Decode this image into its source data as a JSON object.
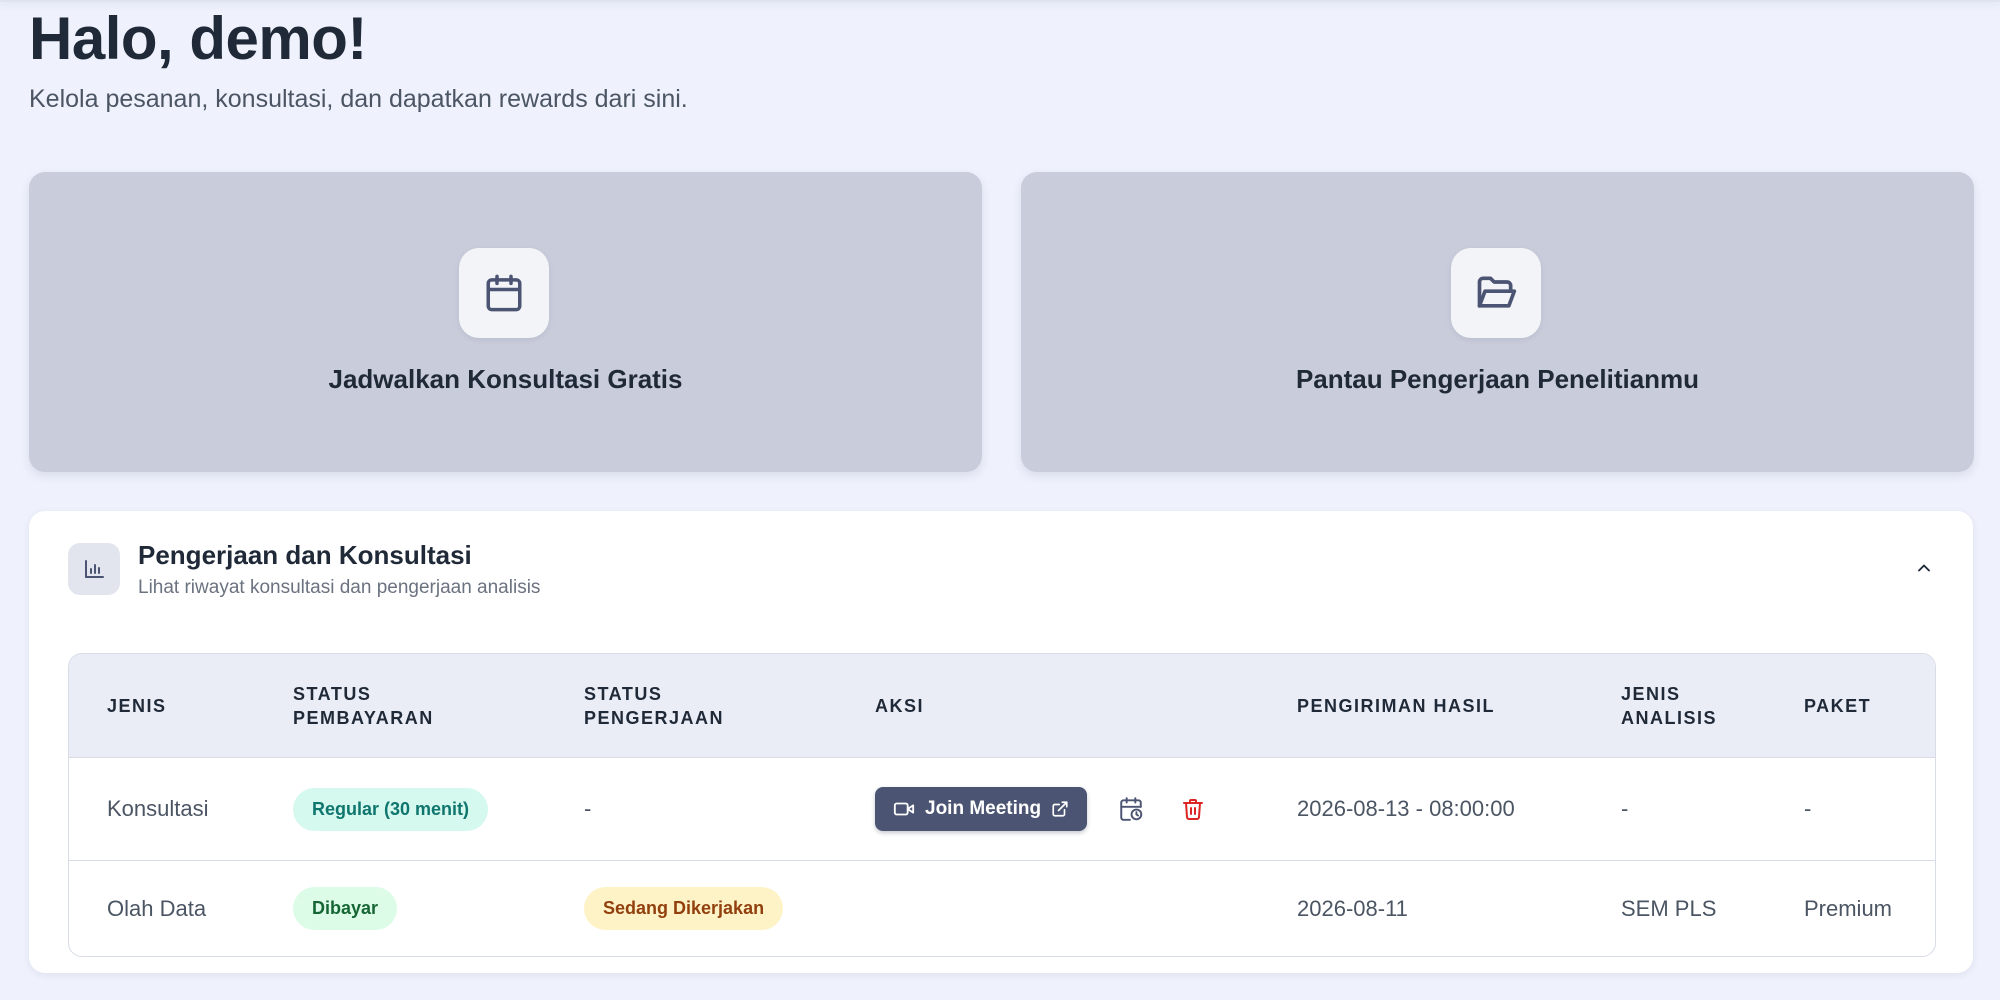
{
  "header": {
    "greeting": "Halo, demo!",
    "subtitle": "Kelola pesanan, konsultasi, dan dapatkan rewards dari sini."
  },
  "cards": [
    {
      "label": "Jadwalkan Konsultasi Gratis",
      "icon": "calendar-icon"
    },
    {
      "label": "Pantau Pengerjaan Penelitianmu",
      "icon": "folder-open-icon"
    }
  ],
  "panel": {
    "title": "Pengerjaan dan Konsultasi",
    "subtitle": "Lihat riwayat konsultasi dan pengerjaan analisis",
    "icon": "bar-chart-icon",
    "collapse_icon": "chevron-up-icon"
  },
  "table": {
    "headers": {
      "jenis": "JENIS",
      "status_pembayaran_1": "STATUS",
      "status_pembayaran_2": "PEMBAYARAN",
      "status_pengerjaan_1": "STATUS",
      "status_pengerjaan_2": "PENGERJAAN",
      "aksi": "AKSI",
      "pengiriman": "PENGIRIMAN HASIL",
      "jenis_analisis_1": "JENIS",
      "jenis_analisis_2": "ANALISIS",
      "paket": "PAKET"
    },
    "rows": [
      {
        "jenis": "Konsultasi",
        "status_pembayaran": "Regular (30 menit)",
        "status_pengerjaan": "-",
        "aksi_join": "Join Meeting",
        "pengiriman": "2026-08-13 - 08:00:00",
        "jenis_analisis": "-",
        "paket": "-"
      },
      {
        "jenis": "Olah Data",
        "status_pembayaran": "Dibayar",
        "status_pengerjaan": "Sedang Dikerjakan",
        "pengiriman": "2026-08-11",
        "jenis_analisis": "SEM PLS",
        "paket": "Premium"
      }
    ]
  },
  "colors": {
    "background": "#eff2fd",
    "card": "#c9ccdb",
    "join_button": "#4b5472",
    "delete_icon": "#dc2626",
    "badge_teal": "#d5f8ef",
    "badge_green": "#dcfce7",
    "badge_yellow": "#fef3c7"
  }
}
